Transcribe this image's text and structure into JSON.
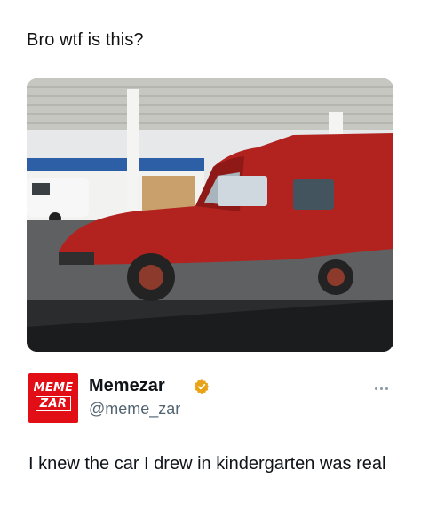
{
  "caption": "Bro wtf is this?",
  "photo": {
    "subject": "red-car-at-gas-station",
    "colors": {
      "car": "#b2231f",
      "sky": "#dfe4e8",
      "ground": "#5f6062"
    }
  },
  "author": {
    "avatar_line1": "MEME",
    "avatar_line2": "ZAR",
    "avatar_color": "#e10e16",
    "name": "Memezar",
    "verified": true,
    "badge_color": "#e8a317",
    "handle": "@meme_zar"
  },
  "more_icon": "ellipsis-icon",
  "tweet": {
    "text": "I knew the car I drew in kindergarten was real"
  }
}
